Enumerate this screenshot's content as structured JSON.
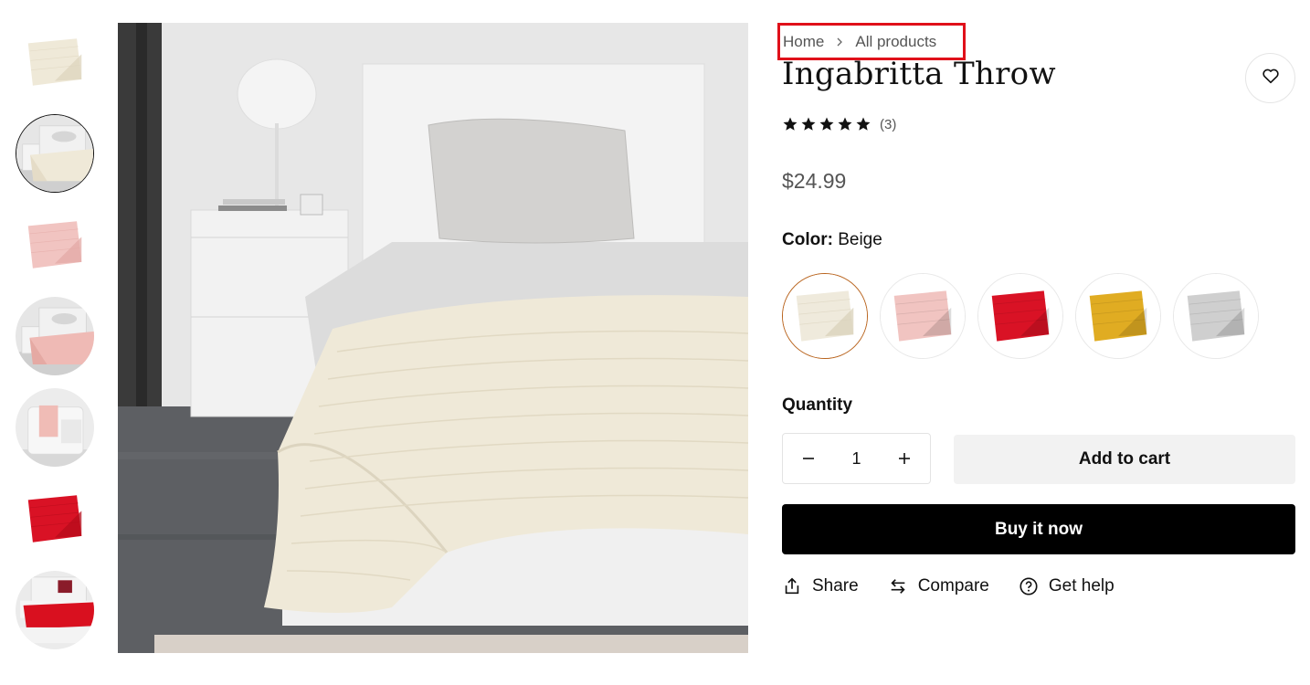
{
  "breadcrumb": {
    "home": "Home",
    "current": "All products"
  },
  "product": {
    "title": "Ingabritta Throw",
    "rating_count": "(3)",
    "rating_stars": 5,
    "price": "$24.99",
    "color_label": "Color:",
    "color_value": "Beige"
  },
  "thumbnails": [
    {
      "name": "thumbnail-beige-throw",
      "active": false
    },
    {
      "name": "thumbnail-beige-bed",
      "active": true
    },
    {
      "name": "thumbnail-pink-throw",
      "active": false
    },
    {
      "name": "thumbnail-pink-bed",
      "active": false
    },
    {
      "name": "thumbnail-pink-chair",
      "active": false
    },
    {
      "name": "thumbnail-red-throw",
      "active": false
    },
    {
      "name": "thumbnail-red-bed",
      "active": false
    }
  ],
  "swatches": [
    {
      "name": "swatch-beige",
      "color": "#efeadc",
      "active": true
    },
    {
      "name": "swatch-pink",
      "color": "#f1c4c1",
      "active": false
    },
    {
      "name": "swatch-red",
      "color": "#d91225",
      "active": false
    },
    {
      "name": "swatch-yellow",
      "color": "#e0ac22",
      "active": false
    },
    {
      "name": "swatch-grey",
      "color": "#cfcfcf",
      "active": false
    }
  ],
  "quantity": {
    "label": "Quantity",
    "value": "1",
    "minus": "−",
    "plus": "+"
  },
  "buttons": {
    "add_to_cart": "Add to cart",
    "buy_now": "Buy it now"
  },
  "actions": {
    "share": "Share",
    "compare": "Compare",
    "help": "Get help"
  },
  "colors": {
    "accent": "#b8621b",
    "breadcrumb_highlight": "#e0101a",
    "buy_bg": "#000000",
    "cart_bg": "#f2f2f2"
  },
  "icons": {
    "wishlist": "heart-icon",
    "share": "share-icon",
    "compare": "compare-arrows-icon",
    "help": "question-circle-icon",
    "separator": "chevron-right-icon",
    "star": "star-icon"
  }
}
